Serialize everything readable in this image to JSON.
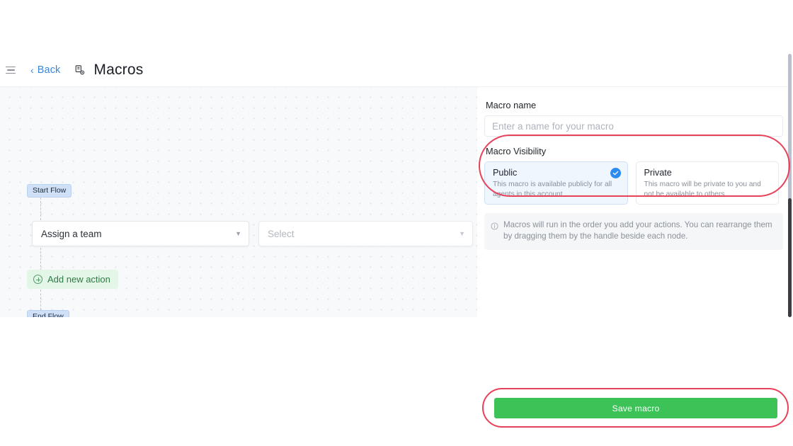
{
  "header": {
    "menu_icon": "hamburger-menu-icon",
    "back_label": "Back",
    "back_chevron": "‹",
    "brand_icon": "macro-flow-icon",
    "title": "Macros"
  },
  "canvas": {
    "start_badge": "Start Flow",
    "end_badge": "End Flow",
    "action_node": {
      "action_select_value": "Assign a team",
      "target_select_placeholder": "Select",
      "caret_icon": "chevron-down-icon"
    },
    "add_action": {
      "label": "Add new action",
      "icon": "plus-circle-icon"
    }
  },
  "panel": {
    "macro_name": {
      "label": "Macro name",
      "value": "",
      "placeholder": "Enter a name for your macro"
    },
    "visibility": {
      "label": "Macro Visibility",
      "selected": "Public",
      "options": [
        {
          "title": "Public",
          "description": "This macro is available publicly for all agents in this account.",
          "selected": true,
          "check_icon": "check-circle-icon"
        },
        {
          "title": "Private",
          "description": "This macro will be private to you and not be available to others.",
          "selected": false
        }
      ]
    },
    "hint": {
      "icon": "info-circle-icon",
      "text": "Macros will run in the order you add your actions. You can rearrange them by dragging them by the handle beside each node."
    }
  },
  "footer": {
    "save_label": "Save macro"
  },
  "annotations": {
    "color": "#e8415a",
    "highlighted": [
      "Macro Visibility",
      "Save macro"
    ]
  },
  "colors": {
    "accent_blue": "#2d8cf0",
    "link_blue": "#3b88d8",
    "save_green": "#3dc258",
    "add_action_green_bg": "#e3f6e7",
    "flow_badge_blue": "#cfe0f7",
    "canvas_bg": "#f7f9fb",
    "annotation_red": "#e8415a"
  }
}
